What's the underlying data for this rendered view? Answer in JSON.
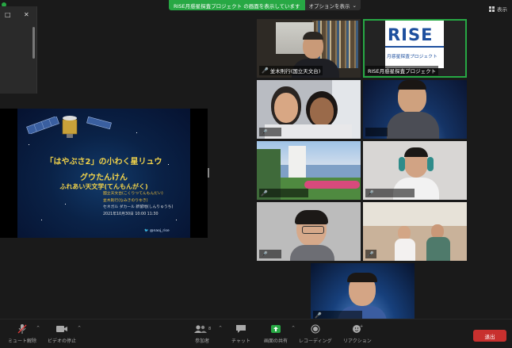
{
  "banner": {
    "sharing_text": "RISE月惑星探査プロジェクト の画面を表示しています",
    "options_label": "オプションを表示"
  },
  "view_label": "表示",
  "window_controls": {
    "restore": "□",
    "close": "✕"
  },
  "slide": {
    "title_line1": "「はやぶさ2」の小わく星リュウ",
    "title_line2": "グウたんけん",
    "title_line3": "ふれあい天文学(てんもんがく)",
    "info_lines": [
      "國立天文台(こくりつてんもんだい)",
      "並木則行(なみきのりゆき)",
      "セネガル ダカール 新留地(しんりゅうち)",
      "2021年10月30日 10:00 11:30"
    ],
    "twitter": "@naoj_rise"
  },
  "participants": [
    {
      "name": "並木則行(国立天文台)",
      "muted": true
    },
    {
      "name": "RISE月惑星探査プロジェクト",
      "muted": false,
      "logo_text": "RISE",
      "logo_sub": "月惑星探査プロジェクト",
      "active_speaker": true
    },
    {
      "name": "",
      "muted": true
    },
    {
      "name": "",
      "muted": false
    },
    {
      "name": "",
      "muted": true
    },
    {
      "name": "",
      "muted": true
    },
    {
      "name": "",
      "muted": true
    },
    {
      "name": "",
      "muted": true
    },
    {
      "name": "",
      "muted": true
    }
  ],
  "toolbar": {
    "mute": "ミュート解除",
    "video": "ビデオの停止",
    "participants": "参加者",
    "participants_count": "8",
    "chat": "チャット",
    "share": "画面の共有",
    "record": "レコーディング",
    "reactions": "リアクション",
    "end": "退出"
  },
  "colors": {
    "accent_green": "#27a844",
    "end_red": "#c8302e",
    "slide_title": "#f2d34a"
  }
}
